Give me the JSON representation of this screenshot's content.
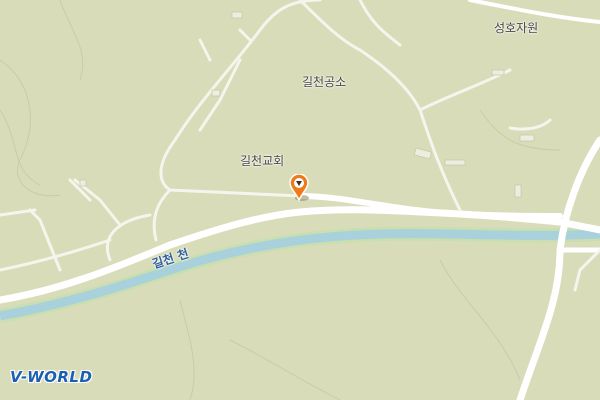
{
  "map": {
    "labels": {
      "seongho_jawon": "성호자원",
      "gilcheon_gongso": "길천공소",
      "gilcheon_church": "길천교회",
      "gilcheon_stream": "길천 천"
    },
    "logo": "V-WORLD",
    "colors": {
      "land": "#d9dcb8",
      "road": "#ffffff",
      "river": "#a9d1dc",
      "river_edge": "#c9dfb0",
      "marker": "#ee7a1a"
    },
    "icons": {
      "marker": "location-pin-icon"
    }
  }
}
